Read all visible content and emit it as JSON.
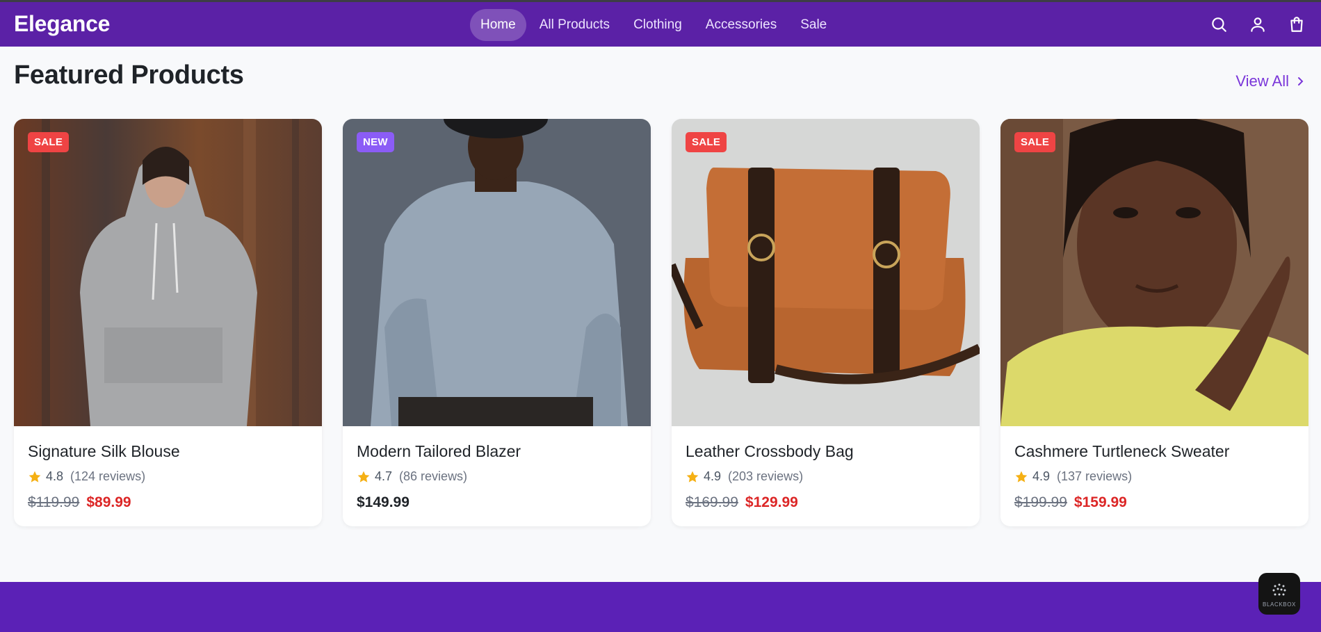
{
  "header": {
    "brand": "Elegance",
    "nav": [
      {
        "label": "Home",
        "active": true
      },
      {
        "label": "All Products",
        "active": false
      },
      {
        "label": "Clothing",
        "active": false
      },
      {
        "label": "Accessories",
        "active": false
      },
      {
        "label": "Sale",
        "active": false
      }
    ],
    "icons": [
      "search-icon",
      "user-icon",
      "shopping-bag-icon"
    ]
  },
  "section": {
    "title": "Featured Products",
    "view_all": "View All"
  },
  "products": [
    {
      "badge": "SALE",
      "name": "Signature Silk Blouse",
      "rating": "4.8",
      "reviews": "(124 reviews)",
      "old_price": "$119.99",
      "price": "$89.99"
    },
    {
      "badge": "NEW",
      "name": "Modern Tailored Blazer",
      "rating": "4.7",
      "reviews": "(86 reviews)",
      "price": "$149.99"
    },
    {
      "badge": "SALE",
      "name": "Leather Crossbody Bag",
      "rating": "4.9",
      "reviews": "(203 reviews)",
      "old_price": "$169.99",
      "price": "$129.99"
    },
    {
      "badge": "SALE",
      "name": "Cashmere Turtleneck Sweater",
      "rating": "4.9",
      "reviews": "(137 reviews)",
      "old_price": "$199.99",
      "price": "$159.99"
    }
  ],
  "fab": {
    "label": "BLACKBOX"
  },
  "colors": {
    "primary": "#5b21a6",
    "accent": "#7a36d9",
    "sale_badge": "#ef4444",
    "new_badge": "#8b5cf6",
    "sale_price": "#dc2626",
    "star": "#f5b014"
  }
}
